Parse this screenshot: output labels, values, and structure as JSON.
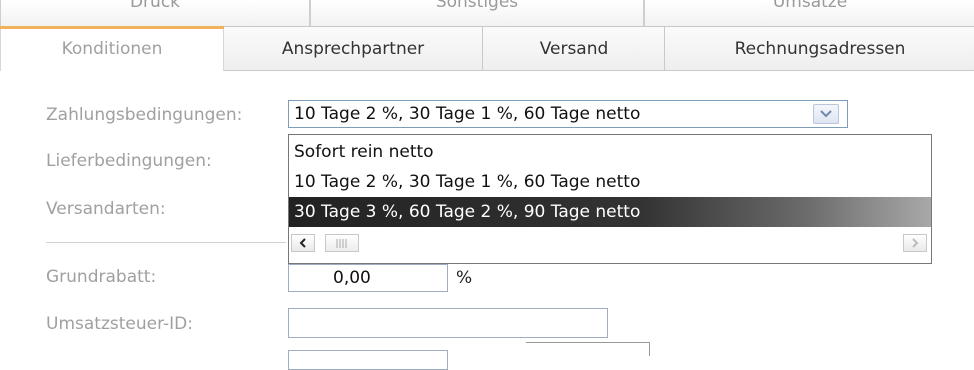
{
  "tabs_top": [
    {
      "label": "Druck"
    },
    {
      "label": "Sonstiges"
    },
    {
      "label": "Umsätze"
    }
  ],
  "tabs": [
    {
      "label": "Konditionen",
      "active": true
    },
    {
      "label": "Ansprechpartner",
      "active": false
    },
    {
      "label": "Versand",
      "active": false
    },
    {
      "label": "Rechnungsadressen",
      "active": false
    }
  ],
  "form": {
    "zahlungsbedingungen_label": "Zahlungsbedingungen:",
    "lieferbedingungen_label": "Lieferbedingungen:",
    "versandarten_label": "Versandarten:",
    "grundrabatt_label": "Grundrabatt:",
    "umsatzsteuer_label": "Umsatzsteuer-ID:",
    "zahlungsbedingungen_value": "10 Tage 2 %, 30 Tage 1 %,  60 Tage netto",
    "grundrabatt_value": "0,00",
    "grundrabatt_unit": "%",
    "umsatzsteuer_value": ""
  },
  "dropdown": {
    "options": [
      {
        "label": "Sofort rein netto",
        "selected": false
      },
      {
        "label": "10 Tage 2 %, 30 Tage 1 %,  60 Tage netto",
        "selected": false
      },
      {
        "label": "30 Tage 3 %, 60 Tage 2 %,  90 Tage netto",
        "selected": true
      }
    ]
  },
  "icons": {
    "combo_arrow": "chevron-down-icon",
    "scroll_left": "arrow-left-icon",
    "scroll_right": "arrow-right-icon",
    "scroll_thumb": "grip-icon"
  },
  "colors": {
    "active_tab_accent": "#f0b35c",
    "selection_bg": "#222222",
    "input_border": "#7e9db9"
  }
}
